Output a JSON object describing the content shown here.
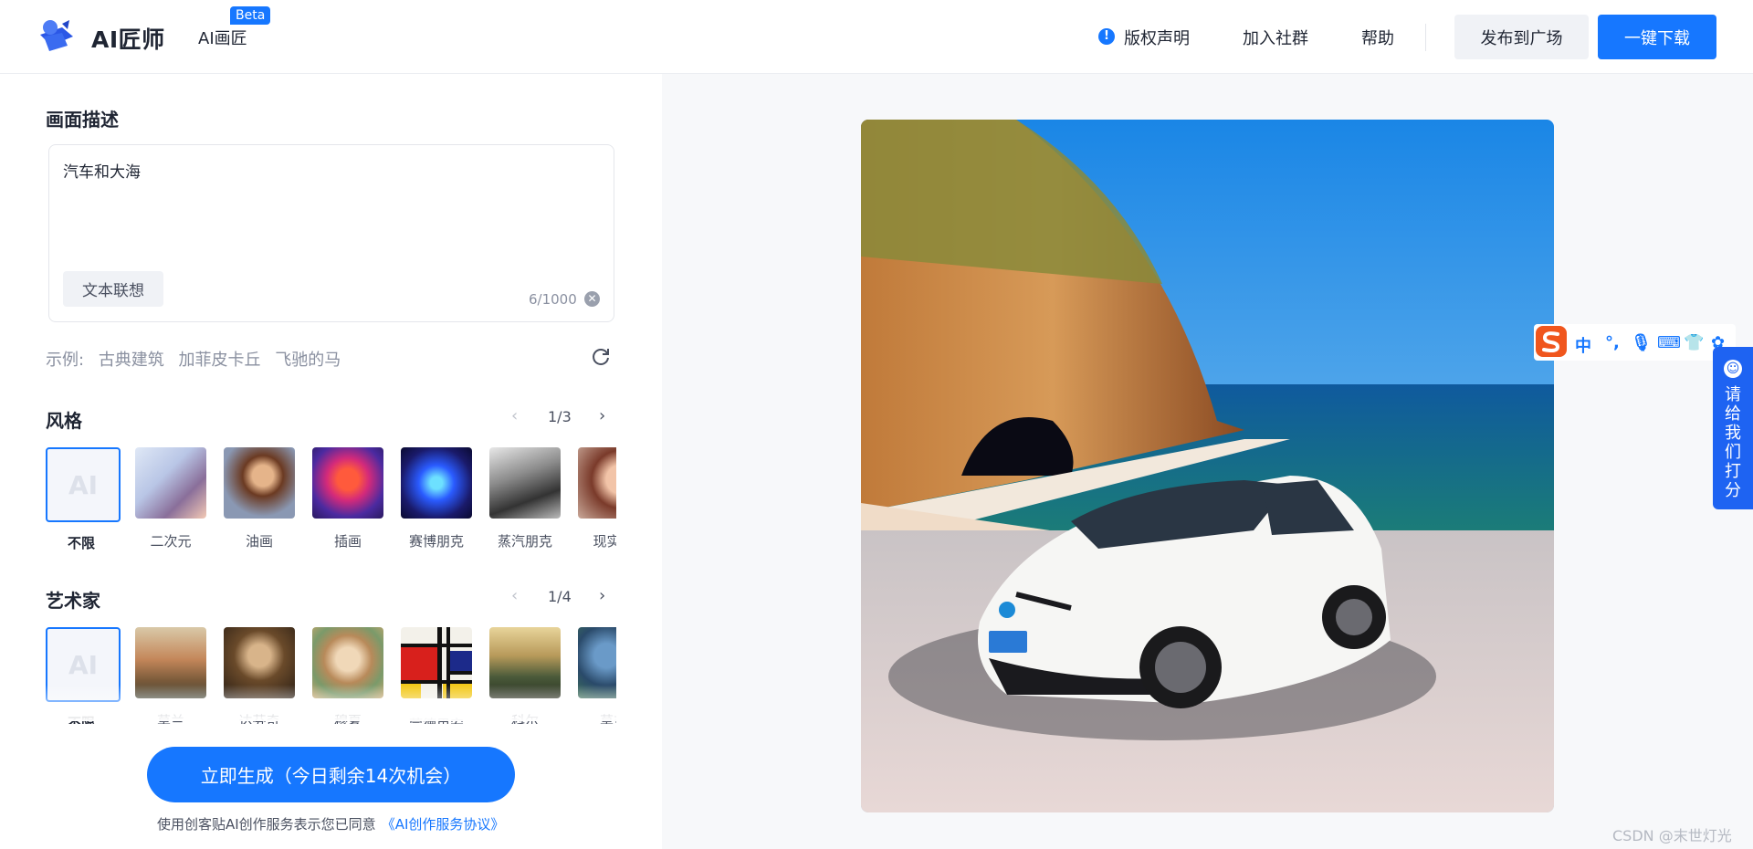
{
  "header": {
    "brand": "AI匠师",
    "product": "AI画匠",
    "badge": "Beta",
    "nav": [
      "版权声明",
      "加入社群",
      "帮助"
    ],
    "publish_label": "发布到广场",
    "download_label": "一键下载"
  },
  "prompt": {
    "title": "画面描述",
    "value": "汽车和大海",
    "assoc_label": "文本联想",
    "counter": "6/1000"
  },
  "examples": {
    "prefix": "示例:",
    "items": [
      "古典建筑",
      "加菲皮卡丘",
      "飞驰的马"
    ]
  },
  "style": {
    "title": "风格",
    "page": "1/3",
    "items": [
      "不限",
      "二次元",
      "油画",
      "插画",
      "赛博朋克",
      "蒸汽朋克",
      "现实照"
    ]
  },
  "artist": {
    "title": "艺术家",
    "page": "1/4",
    "items": [
      "不限",
      "莫兰",
      "达芬奇",
      "穆夏",
      "蒙德里安",
      "科尔",
      "莫奈"
    ]
  },
  "ai_tile_text": "AI",
  "generate_label": "立即生成（今日剩余14次机会）",
  "agreement": {
    "text": "使用创客贴AI创作服务表示您已同意",
    "link": "《AI创作服务协议》"
  },
  "ime": {
    "items": [
      "中",
      "°,"
    ]
  },
  "rating": {
    "label": "请给我们打分"
  },
  "watermark": "CSDN @末世灯光",
  "colors": {
    "accent": "#1677ff",
    "rating_tab": "#1e63f2",
    "ime_logo": "#f0561d"
  }
}
